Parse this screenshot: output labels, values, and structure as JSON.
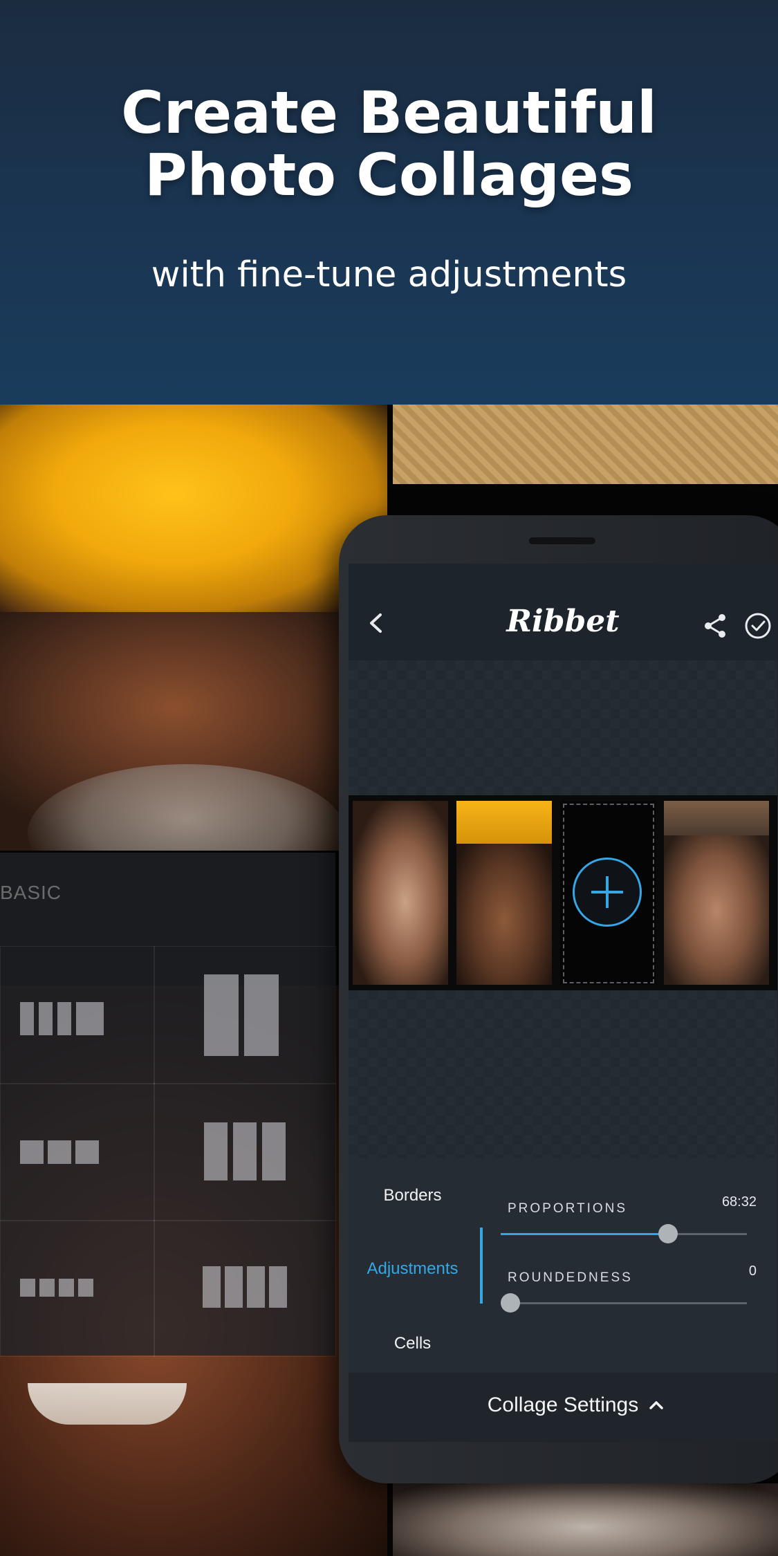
{
  "header": {
    "headline_line1": "Create Beautiful",
    "headline_line2": "Photo Collages",
    "subheadline": "with fine-tune adjustments"
  },
  "ghost_panel": {
    "label": "BASIC"
  },
  "app": {
    "logo": "Ribbet",
    "back_icon": "chevron-left-icon",
    "share_icon": "share-icon",
    "confirm_icon": "check-circle-icon",
    "add_cell_icon": "plus-circle-icon"
  },
  "settings_panel": {
    "menu": [
      {
        "label": "Borders",
        "active": false
      },
      {
        "label": "Adjustments",
        "active": true
      },
      {
        "label": "Cells",
        "active": false
      }
    ],
    "sliders": [
      {
        "label": "PROPORTIONS",
        "value_text": "68:32",
        "fraction": 0.68
      },
      {
        "label": "ROUNDEDNESS",
        "value_text": "0",
        "fraction": 0.0
      }
    ],
    "footer_label": "Collage Settings",
    "footer_icon": "chevron-up-icon"
  },
  "colors": {
    "accent": "#36a7e5",
    "header_top": "#1b2c3f",
    "header_bottom": "#1a3c5c",
    "panel_bg": "#262c33"
  }
}
